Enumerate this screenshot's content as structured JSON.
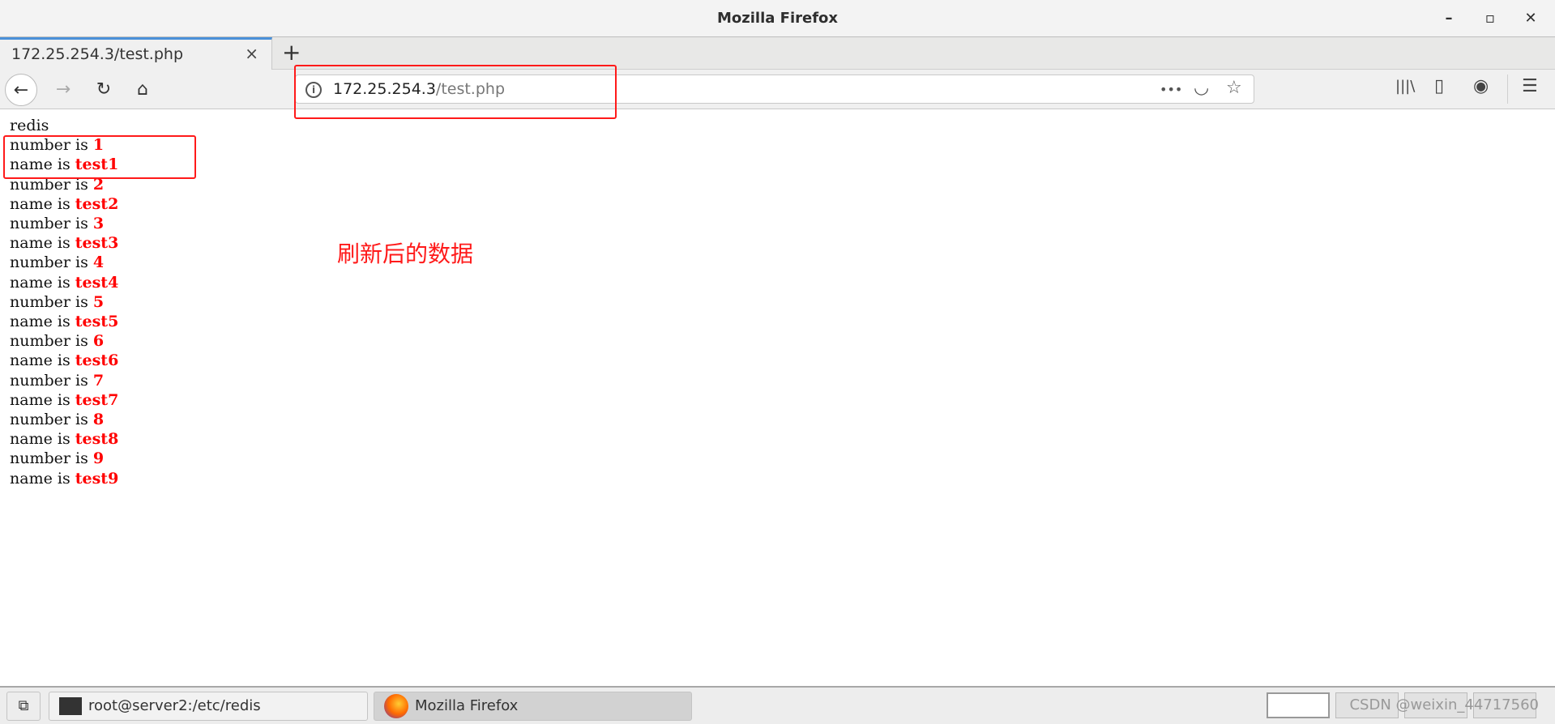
{
  "window": {
    "title": "Mozilla Firefox",
    "minimize": "–",
    "maximize": "▫",
    "close": "✕"
  },
  "tab": {
    "title": "172.25.254.3/test.php",
    "close": "×",
    "new_tab": "+"
  },
  "nav": {
    "back": "←",
    "forward": "→",
    "reload": "↻",
    "home": "⌂"
  },
  "urlbar": {
    "host": "172.25.254.3",
    "path": "/test.php",
    "info": "i",
    "more": "•••",
    "pocket": "◡",
    "bookmark": "☆"
  },
  "toolbar": {
    "library": "|||\\",
    "sidebar": "▯",
    "account": "◉",
    "menu": "☰"
  },
  "page": {
    "heading": "redis",
    "number_label": "number is ",
    "name_label": "name is ",
    "records": [
      {
        "number": "1",
        "name": "test1"
      },
      {
        "number": "2",
        "name": "test2"
      },
      {
        "number": "3",
        "name": "test3"
      },
      {
        "number": "4",
        "name": "test4"
      },
      {
        "number": "5",
        "name": "test5"
      },
      {
        "number": "6",
        "name": "test6"
      },
      {
        "number": "7",
        "name": "test7"
      },
      {
        "number": "8",
        "name": "test8"
      },
      {
        "number": "9",
        "name": "test9"
      }
    ]
  },
  "annotation": {
    "text": "刷新后的数据",
    "color": "#ff1a1a"
  },
  "taskbar": {
    "terminal": "root@server2:/etc/redis",
    "firefox": "Mozilla Firefox",
    "watermark": "CSDN @weixin_44717560"
  }
}
